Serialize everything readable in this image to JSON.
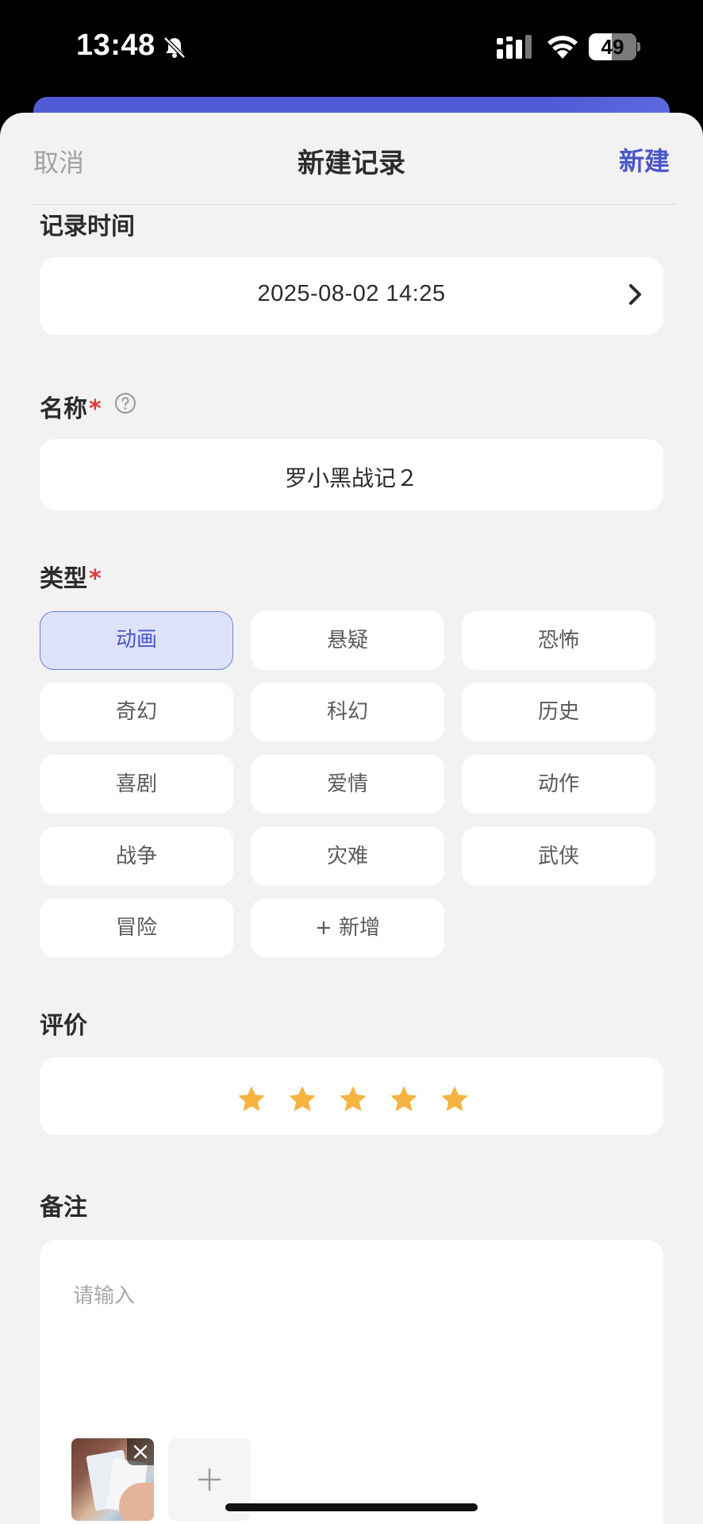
{
  "status_bar": {
    "time": "13:48",
    "battery_level": "49"
  },
  "nav": {
    "cancel_label": "取消",
    "title": "新建记录",
    "create_label": "新建"
  },
  "record_time": {
    "label": "记录时间",
    "value": "2025-08-02 14:25"
  },
  "name": {
    "label": "名称",
    "required_mark": "*",
    "value": "罗小黑战记２"
  },
  "type": {
    "label": "类型",
    "required_mark": "*",
    "chips": [
      {
        "label": "动画",
        "selected": true
      },
      {
        "label": "悬疑",
        "selected": false
      },
      {
        "label": "恐怖",
        "selected": false
      },
      {
        "label": "奇幻",
        "selected": false
      },
      {
        "label": "科幻",
        "selected": false
      },
      {
        "label": "历史",
        "selected": false
      },
      {
        "label": "喜剧",
        "selected": false
      },
      {
        "label": "爱情",
        "selected": false
      },
      {
        "label": "动作",
        "selected": false
      },
      {
        "label": "战争",
        "selected": false
      },
      {
        "label": "灾难",
        "selected": false
      },
      {
        "label": "武侠",
        "selected": false
      },
      {
        "label": "冒险",
        "selected": false
      },
      {
        "label": "+  新增",
        "selected": false
      }
    ]
  },
  "rating": {
    "label": "评价",
    "stars": 5,
    "max_stars": 5,
    "star_color": "#f5b342"
  },
  "note": {
    "label": "备注",
    "placeholder": "请输入"
  },
  "colors": {
    "accent": "#4a56c8",
    "required": "#e33a3a",
    "selected_chip_bg": "#dde2f8"
  }
}
